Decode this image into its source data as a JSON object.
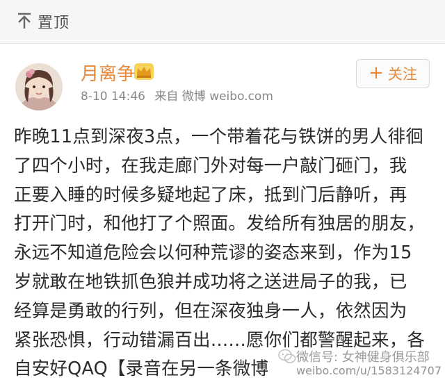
{
  "topbar": {
    "pin_label": "置顶",
    "pin_icon": "pin-top-icon"
  },
  "author": {
    "name": "月离争",
    "badge_icon": "crown-icon",
    "badge_color": "#f0a830",
    "name_color": "#e8893a",
    "avatar_icon": "avatar"
  },
  "post_meta": {
    "time": "8-10 14:46",
    "source": "来自 微博 weibo.com"
  },
  "follow_button": {
    "plus": "+",
    "label": "关注"
  },
  "body_lines": [
    "昨晚11点到深夜3点，一个带着花与铁饼的男人徘徊",
    "了四个小时，在我走廊门外对每一户敲门砸门，我",
    "正要入睡的时候多疑地起了床，抵到门后静听，再",
    "打开门时，和他打了个照面。发给所有独居的朋友，",
    "永远不知道危险会以何种荒谬的姿态来到，作为15",
    "岁就敢在地铁抓色狼并成功将之送进局子的我，已",
    "经算是勇敢的行列，但在深夜独身一人，依然因为",
    "紧张恐惧，行动错漏百出……愿你们都警醒起来，各",
    "自安好QAQ【录音在另一条微博"
  ],
  "watermark": {
    "line1": "微信号: 女神健身俱乐部",
    "line2": "weibo.com/u/1583124707"
  }
}
